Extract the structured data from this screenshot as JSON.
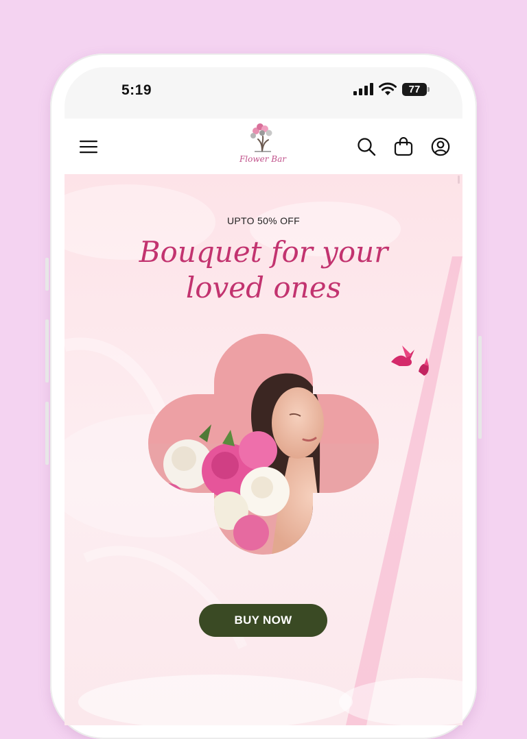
{
  "status_bar": {
    "time": "5:19",
    "battery": "77"
  },
  "header": {
    "logo_text": "Flower Bar",
    "menu_icon": "hamburger-menu-icon",
    "search_icon": "search-icon",
    "cart_icon": "shopping-bag-icon",
    "account_icon": "user-account-icon"
  },
  "hero": {
    "eyebrow": "UPTO 50% OFF",
    "headline_line1": "Bouquet for your",
    "headline_line2": "loved ones",
    "cta_label": "BUY NOW"
  },
  "colors": {
    "page_bg": "#f4d3f1",
    "hero_bg": "#fde3e8",
    "headline": "#c2336f",
    "cta_bg": "#3a4a24",
    "cta_text": "#ffffff"
  }
}
